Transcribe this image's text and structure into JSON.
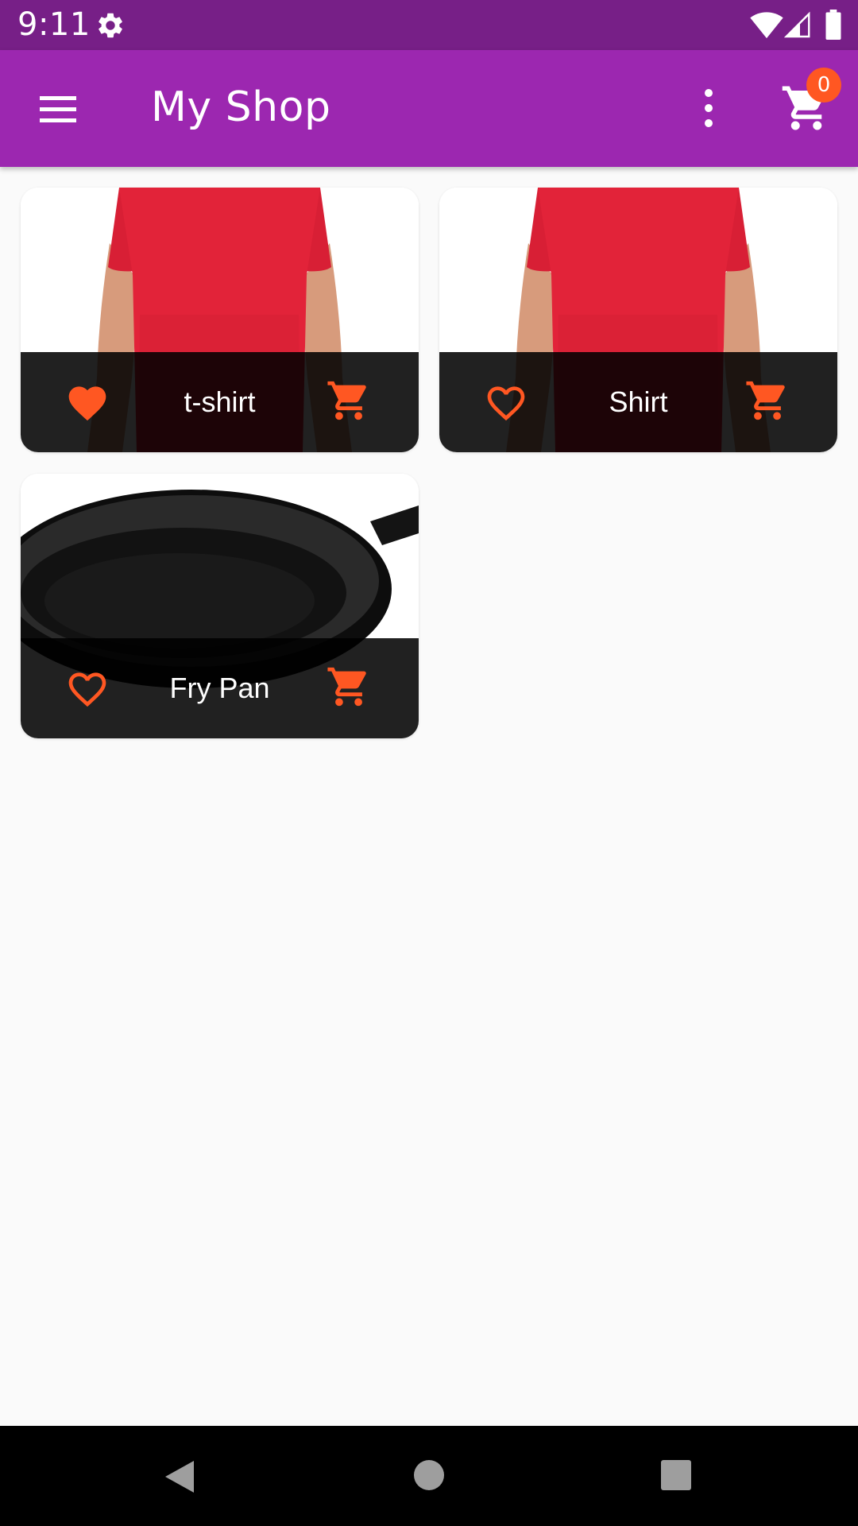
{
  "status_bar": {
    "time": "9:11",
    "icons": [
      "gear-icon",
      "wifi-icon",
      "cell-signal-icon",
      "battery-icon"
    ]
  },
  "app_bar": {
    "title": "My Shop",
    "icons": [
      "menu-icon",
      "more-vert-icon",
      "shopping-cart-icon"
    ],
    "cart_count": "0"
  },
  "products": [
    {
      "title": "t-shirt",
      "favorite": true,
      "image": "red t-shirt"
    },
    {
      "title": "Shirt",
      "favorite": false,
      "image": "red t-shirt"
    },
    {
      "title": "Fry Pan",
      "favorite": false,
      "image": "cast iron pan"
    }
  ],
  "colors": {
    "status_bar": "#771f87",
    "app_bar": "#9c27b0",
    "accent": "#ff5722",
    "card_footer": "#1e1e1e",
    "background": "#fafafa"
  },
  "nav_bar": {
    "icons": [
      "back-icon",
      "home-icon",
      "recents-icon"
    ]
  }
}
